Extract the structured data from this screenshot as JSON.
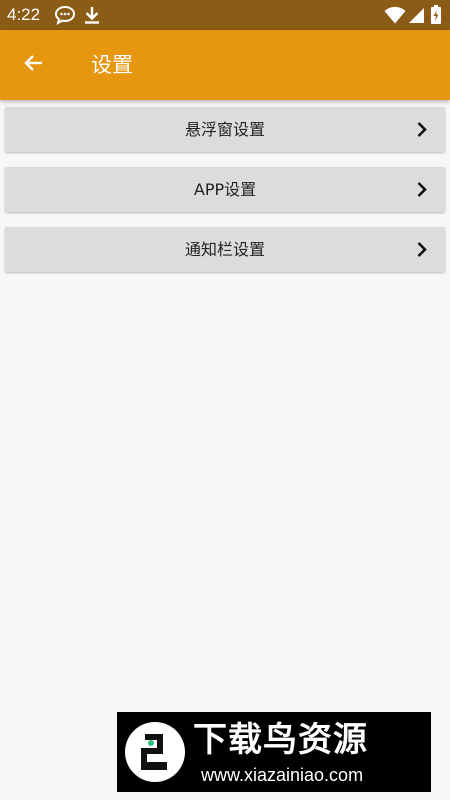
{
  "status_bar": {
    "time": "4:22",
    "icons": [
      "chat-bubble-icon",
      "download-icon",
      "wifi-icon",
      "signal-icon",
      "battery-icon"
    ]
  },
  "app_bar": {
    "title": "设置",
    "back_icon": "arrow-left-icon"
  },
  "menu": {
    "items": [
      {
        "label": "悬浮窗设置",
        "icon": "chevron-right-icon"
      },
      {
        "label": "APP设置",
        "icon": "chevron-right-icon"
      },
      {
        "label": "通知栏设置",
        "icon": "chevron-right-icon"
      }
    ]
  },
  "watermark": {
    "title": "下载鸟资源",
    "url": "www.xiazainiao.com"
  },
  "colors": {
    "status_bar": "#8b5c15",
    "app_bar": "#e6960f",
    "menu_item_bg": "#dcdcdc",
    "page_bg": "#f7f7f7"
  }
}
